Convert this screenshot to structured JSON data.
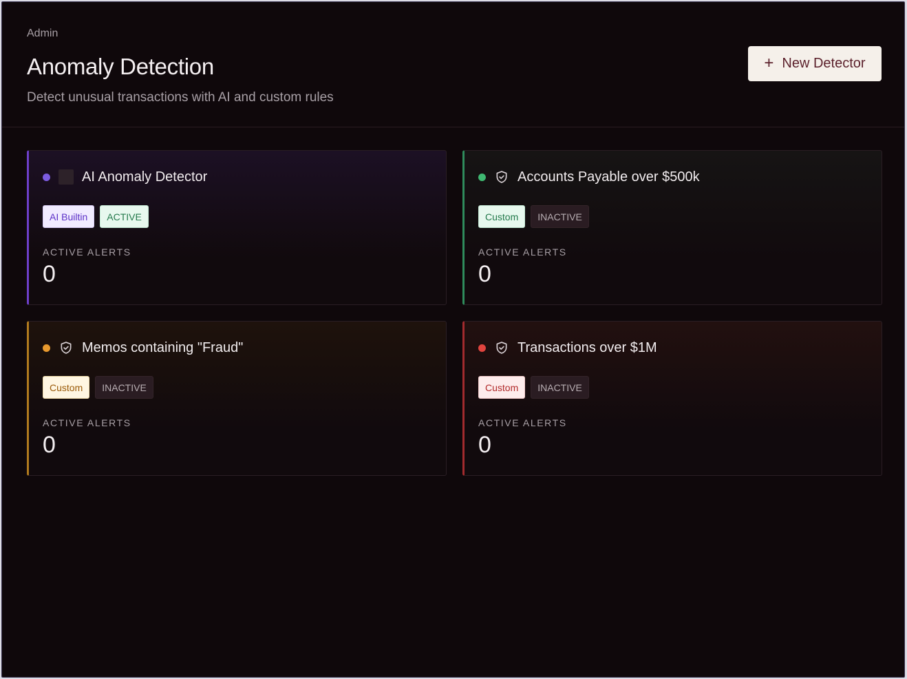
{
  "header": {
    "breadcrumb": "Admin",
    "title": "Anomaly Detection",
    "subtitle": "Detect unusual transactions with AI and custom rules",
    "new_button": {
      "icon": "plus-icon",
      "label": "New Detector"
    }
  },
  "alerts_label": "ACTIVE ALERTS",
  "detectors": [
    {
      "name": "AI Anomaly Detector",
      "status_color": "#7c5ce0",
      "icon": "square-icon",
      "type_badge": "AI Builtin",
      "status_badge": "ACTIVE",
      "active_alerts": "0"
    },
    {
      "name": "Accounts Payable over $500k",
      "status_color": "#3fb871",
      "icon": "shield-icon",
      "type_badge": "Custom",
      "status_badge": "INACTIVE",
      "active_alerts": "0"
    },
    {
      "name": "Memos containing \"Fraud\"",
      "status_color": "#e8992e",
      "icon": "shield-icon",
      "type_badge": "Custom",
      "status_badge": "INACTIVE",
      "active_alerts": "0"
    },
    {
      "name": "Transactions over $1M",
      "status_color": "#e0443e",
      "icon": "shield-icon",
      "type_badge": "Custom",
      "status_badge": "INACTIVE",
      "active_alerts": "0"
    }
  ]
}
